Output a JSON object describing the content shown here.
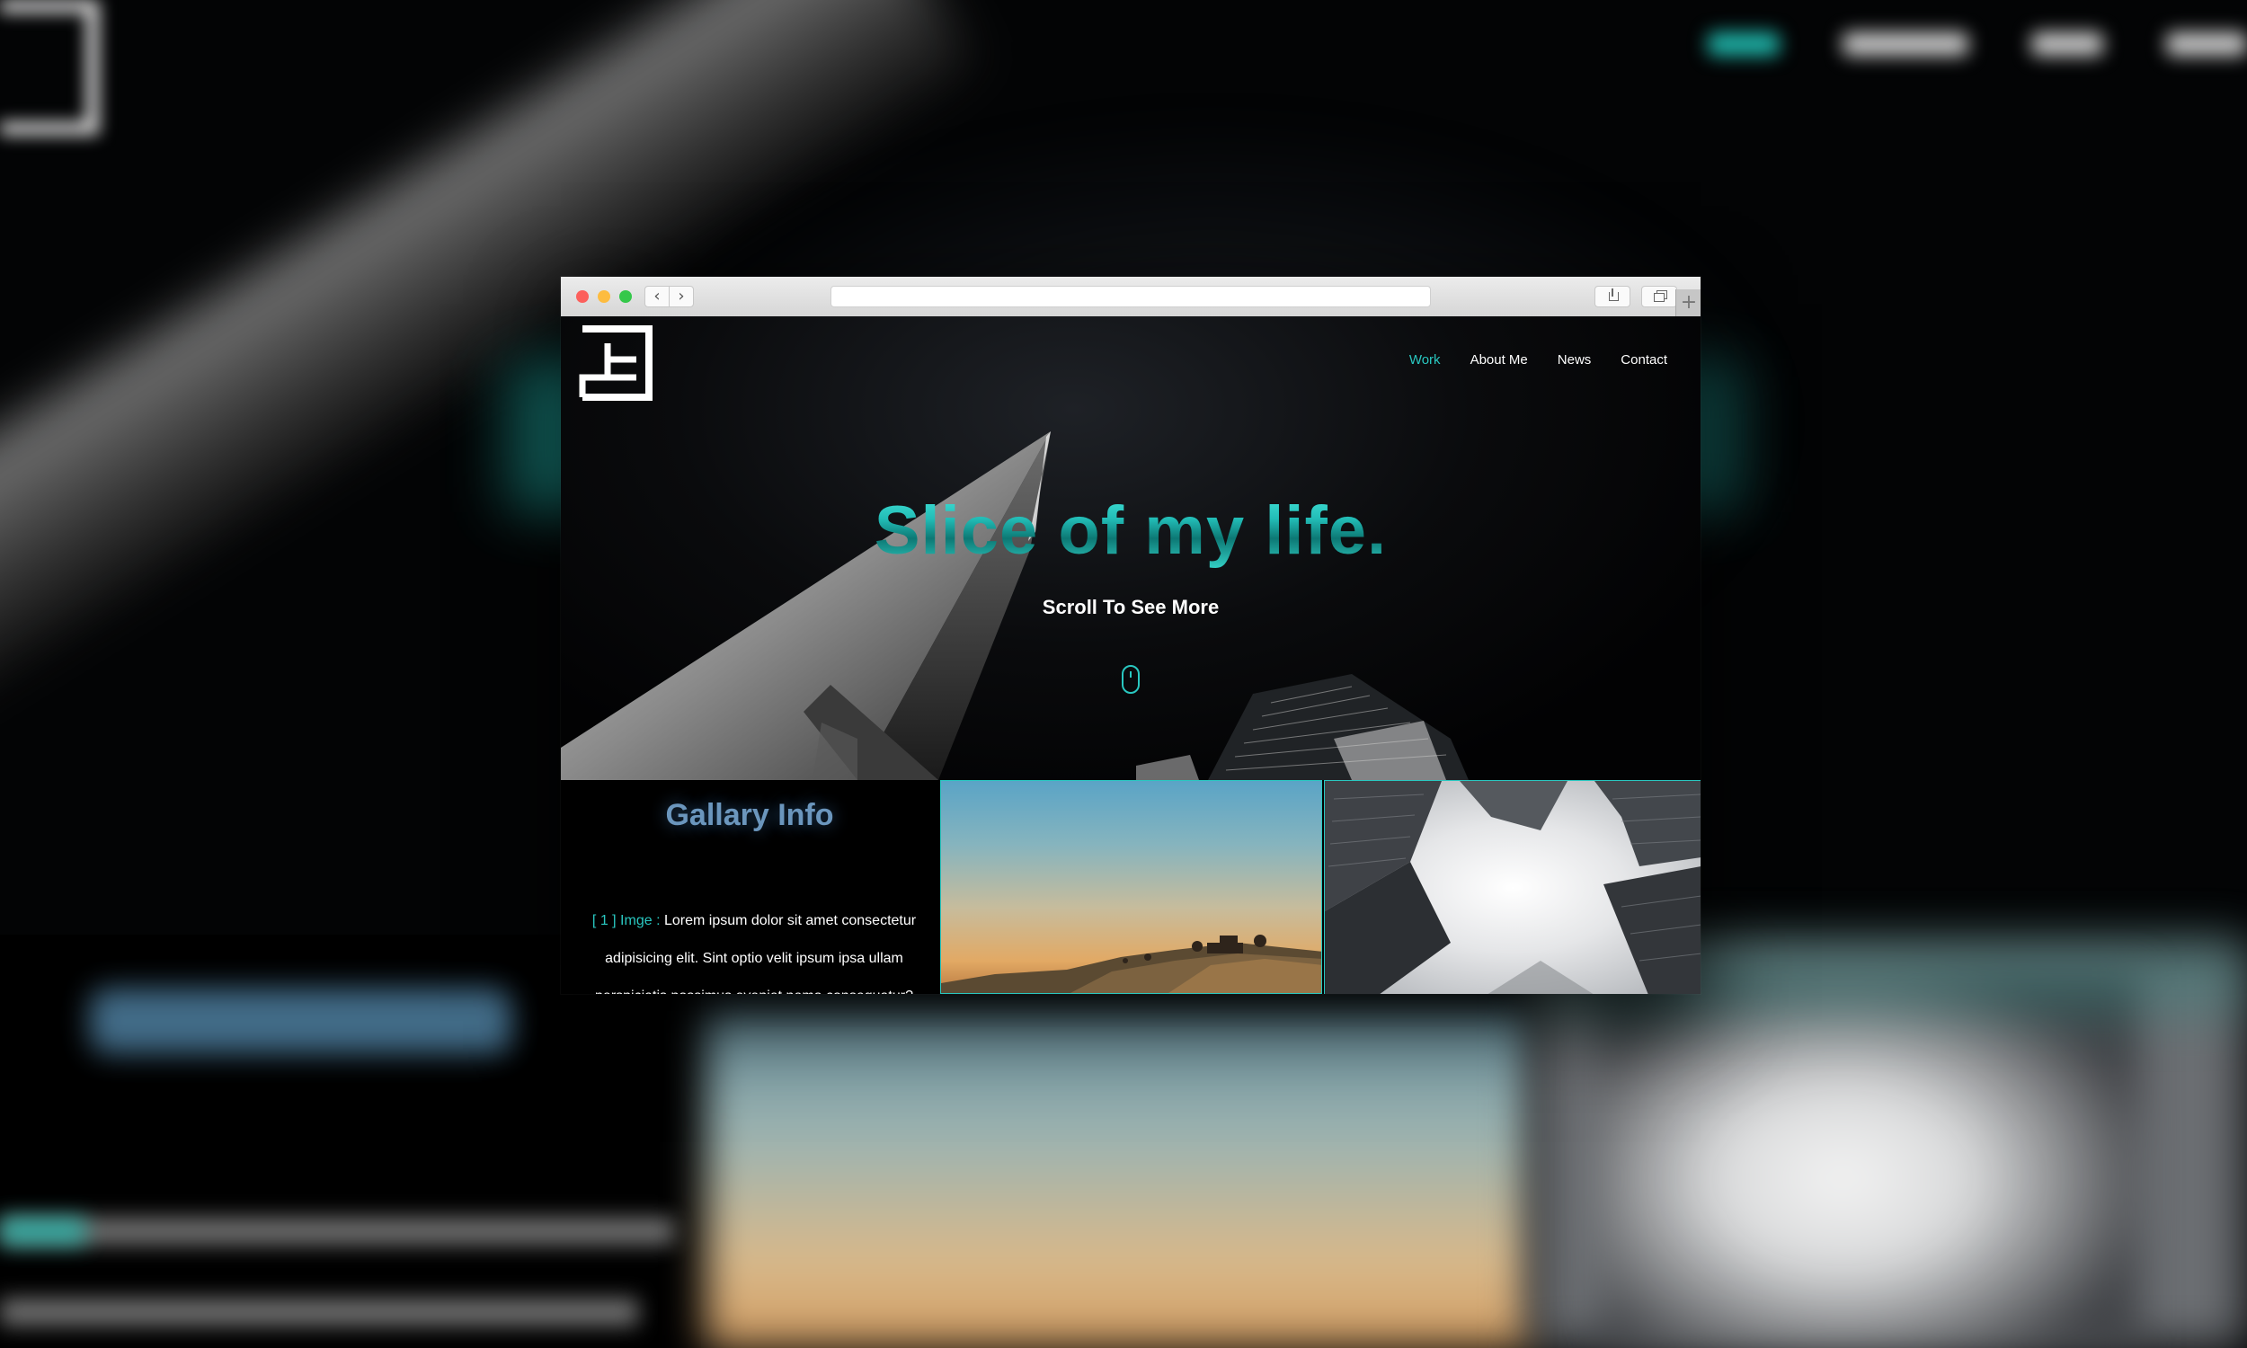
{
  "nav": {
    "items": [
      "Work",
      "About Me",
      "News",
      "Contact"
    ],
    "active": "Work"
  },
  "hero": {
    "title": "Slice of my life.",
    "subtitle": "Scroll To See More"
  },
  "gallery_info": {
    "heading": "Gallary Info",
    "tag": "[ 1 ] Imge :",
    "text": " Lorem ipsum dolor sit amet consectetur adipisicing elit. Sint optio velit ipsum ipsa ullam perspiciatis possimus eveniet nemo consequatur?"
  },
  "colors": {
    "accent": "#29c7c0",
    "heading": "#6b96bd",
    "background": "#000000"
  },
  "icons": [
    "logo-mark",
    "scroll-mouse-icon",
    "back-icon",
    "forward-icon",
    "share-icon",
    "tabs-icon",
    "new-tab-icon"
  ]
}
